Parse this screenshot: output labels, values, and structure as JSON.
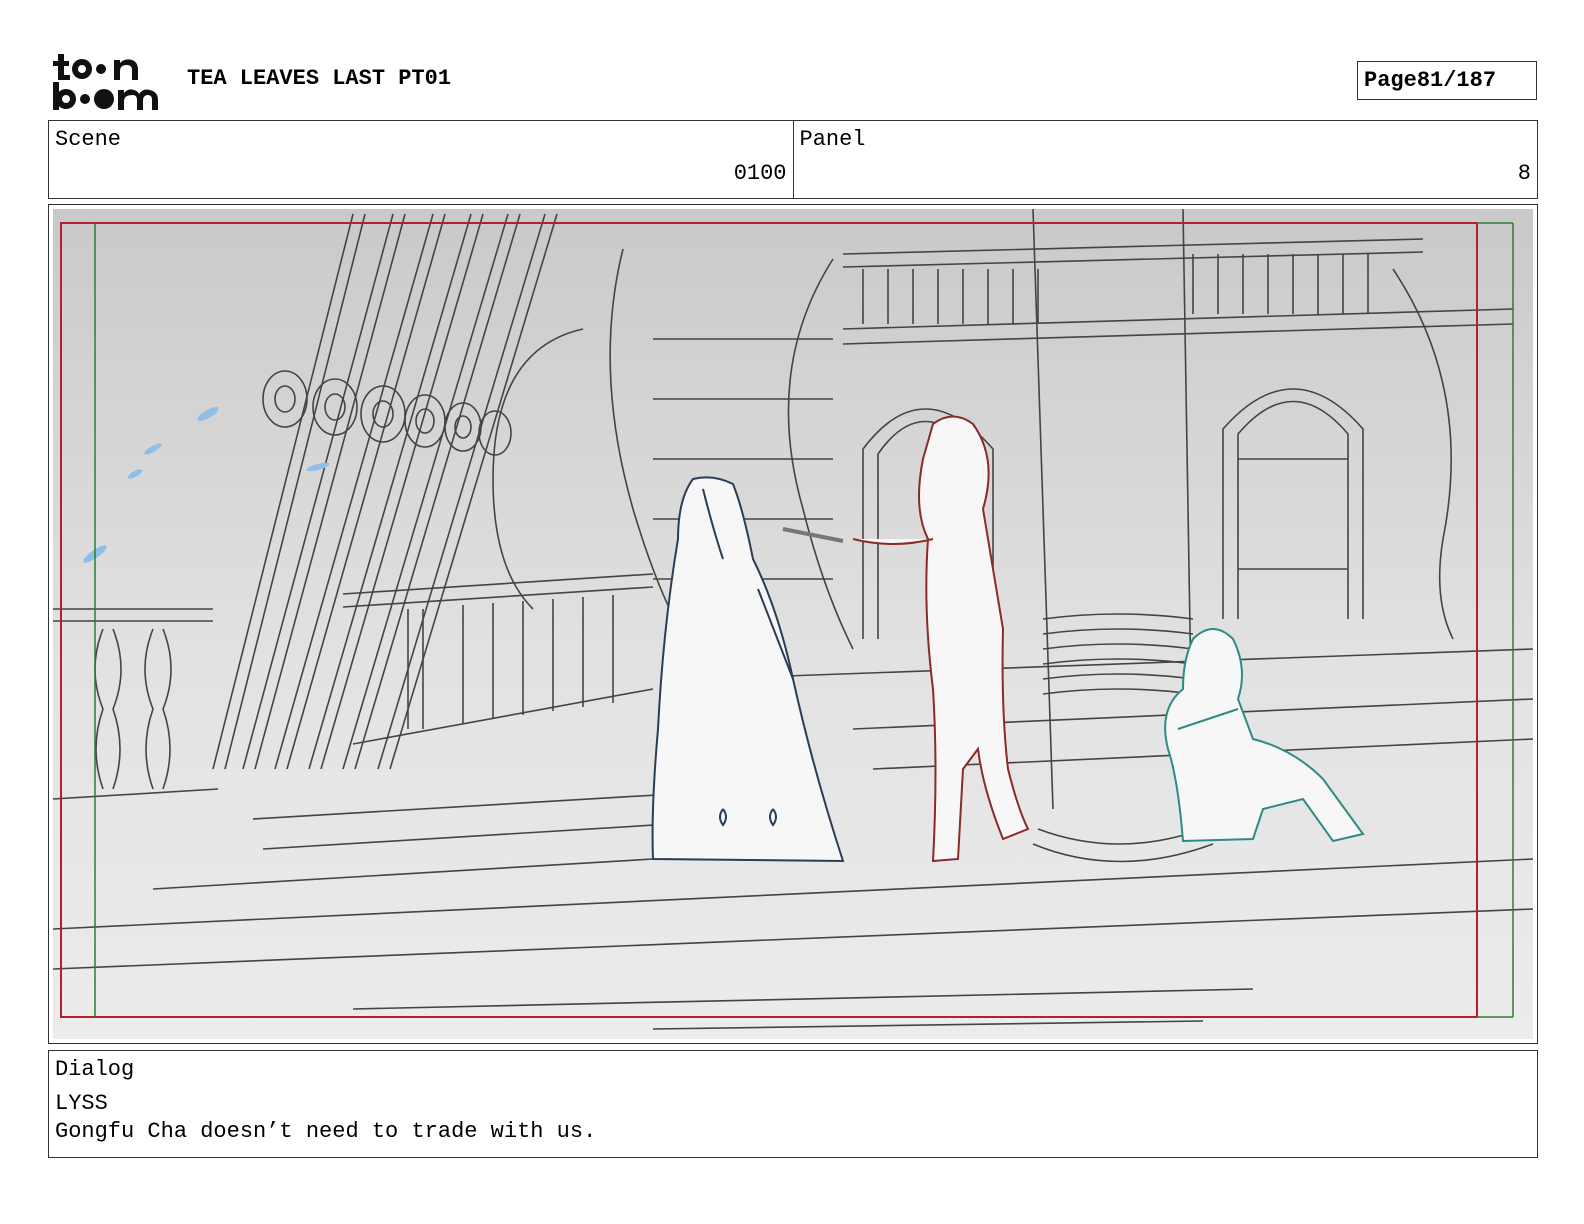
{
  "header": {
    "logo_text_top": "toon",
    "logo_text_bottom": "boom",
    "title": "TEA LEAVES LAST PT01",
    "page_label": "Page",
    "page_value": "81/187"
  },
  "info": {
    "scene_label": "Scene",
    "scene_value": "0100",
    "panel_label": "Panel",
    "panel_value": "8"
  },
  "dialog": {
    "label": "Dialog",
    "speaker": "LYSS",
    "line": "Gongfu Cha doesn’t need to trade with us."
  },
  "colors": {
    "safe_frame": "#b3202c",
    "action_frame": "#2e7d32",
    "char_blue": "#2b3d55",
    "char_red": "#8a2a2a",
    "char_teal": "#2f8a85"
  }
}
